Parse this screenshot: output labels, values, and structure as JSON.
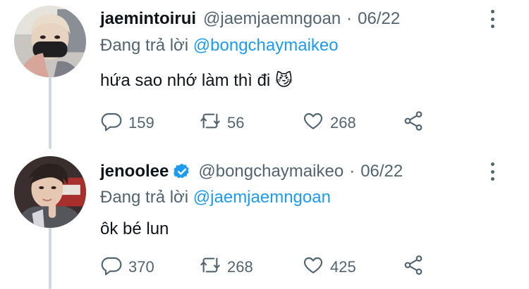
{
  "tweets": [
    {
      "name": "jaemintoirui",
      "handle": "@jaemjaemngoan",
      "separator": "·",
      "date": "06/22",
      "verified": false,
      "reply_prefix": "Đang trả lời",
      "reply_to": "@bongchaymaikeo",
      "text": "hứa sao nhớ làm thì đi 😼",
      "replies": "159",
      "retweets": "56",
      "likes": "268"
    },
    {
      "name": "jenoolee",
      "handle": "@bongchaymaikeo",
      "separator": "·",
      "date": "06/22",
      "verified": true,
      "reply_prefix": "Đang trả lời",
      "reply_to": "@jaemjaemngoan",
      "text": "ôk bé lun",
      "replies": "370",
      "retweets": "268",
      "likes": "425"
    }
  ],
  "icons": {
    "reply": "reply-icon",
    "retweet": "retweet-icon",
    "like": "heart-icon",
    "share": "share-icon",
    "more": "more-icon",
    "verified": "verified-badge-icon"
  },
  "colors": {
    "accent": "#1d9bf0",
    "muted": "#536471",
    "text": "#0f1419",
    "thread_line": "#cfd9de"
  }
}
